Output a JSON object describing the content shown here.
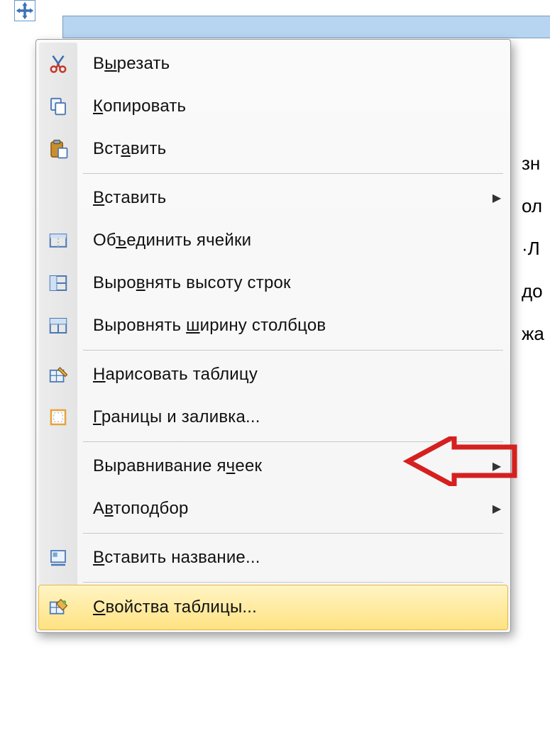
{
  "annotation": {
    "target_item": "borders-and-shading"
  },
  "menu": {
    "cut": {
      "label": "Вырезать",
      "accel_char": "ы"
    },
    "copy": {
      "label": "Копировать",
      "accel_char": "К"
    },
    "paste": {
      "label": "Вставить",
      "accel_char": "а"
    },
    "insert": {
      "label": "Вставить",
      "accel_char": "В",
      "submenu": true
    },
    "merge": {
      "label": "Объединить ячейки",
      "accel_char": "ъ"
    },
    "dist_rows": {
      "label": "Выровнять высоту строк",
      "accel_char": "в"
    },
    "dist_cols": {
      "label": "Выровнять ширину столбцов",
      "accel_char": "ш"
    },
    "draw": {
      "label": "Нарисовать таблицу",
      "accel_char": "Н"
    },
    "borders": {
      "label": "Границы и заливка...",
      "accel_char": "Г"
    },
    "align": {
      "label": "Выравнивание ячеек",
      "accel_char": "ч",
      "submenu": true
    },
    "autofit": {
      "label": "Автоподбор",
      "accel_char": "в",
      "submenu": true
    },
    "caption": {
      "label": "Вставить название...",
      "accel_char": "В"
    },
    "props": {
      "label": "Свойства таблицы...",
      "accel_char": "С"
    }
  },
  "bg_text": [
    "зн",
    "ол",
    "·Л",
    "до",
    "",
    "жа"
  ]
}
